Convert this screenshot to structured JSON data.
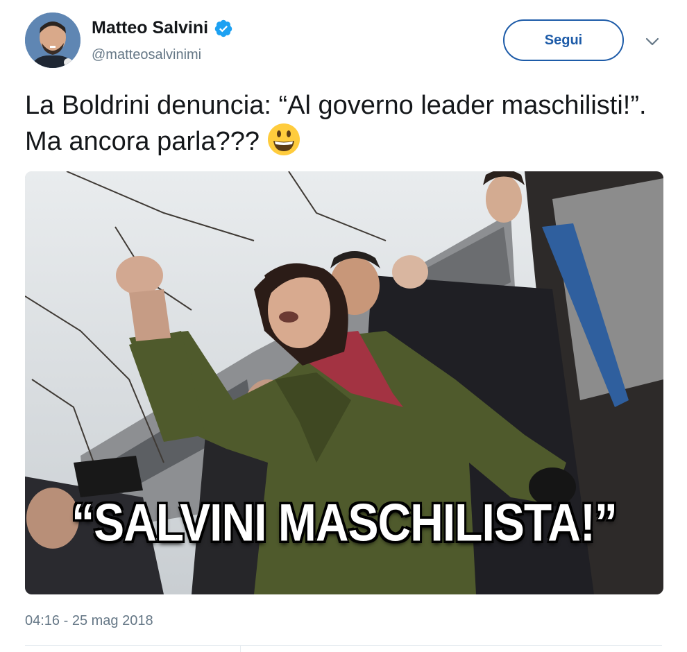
{
  "author": {
    "name": "Matteo Salvini",
    "handle": "@matteosalvinimi",
    "verified": true
  },
  "actions": {
    "follow_label": "Segui",
    "more_icon": "chevron-down-icon"
  },
  "tweet": {
    "text": "La Boldrini denuncia: “Al governo leader maschilisti!”. Ma ancora parla???",
    "emoji": "grinning-face-emoji",
    "timestamp": "04:16 - 25 mag 2018"
  },
  "media": {
    "caption": "“SALVINI MASCHILISTA!”"
  },
  "colors": {
    "accent": "#1d5ba8",
    "verified": "#1da1f2",
    "secondary_text": "#657786",
    "coat": "#4f5a2c"
  }
}
